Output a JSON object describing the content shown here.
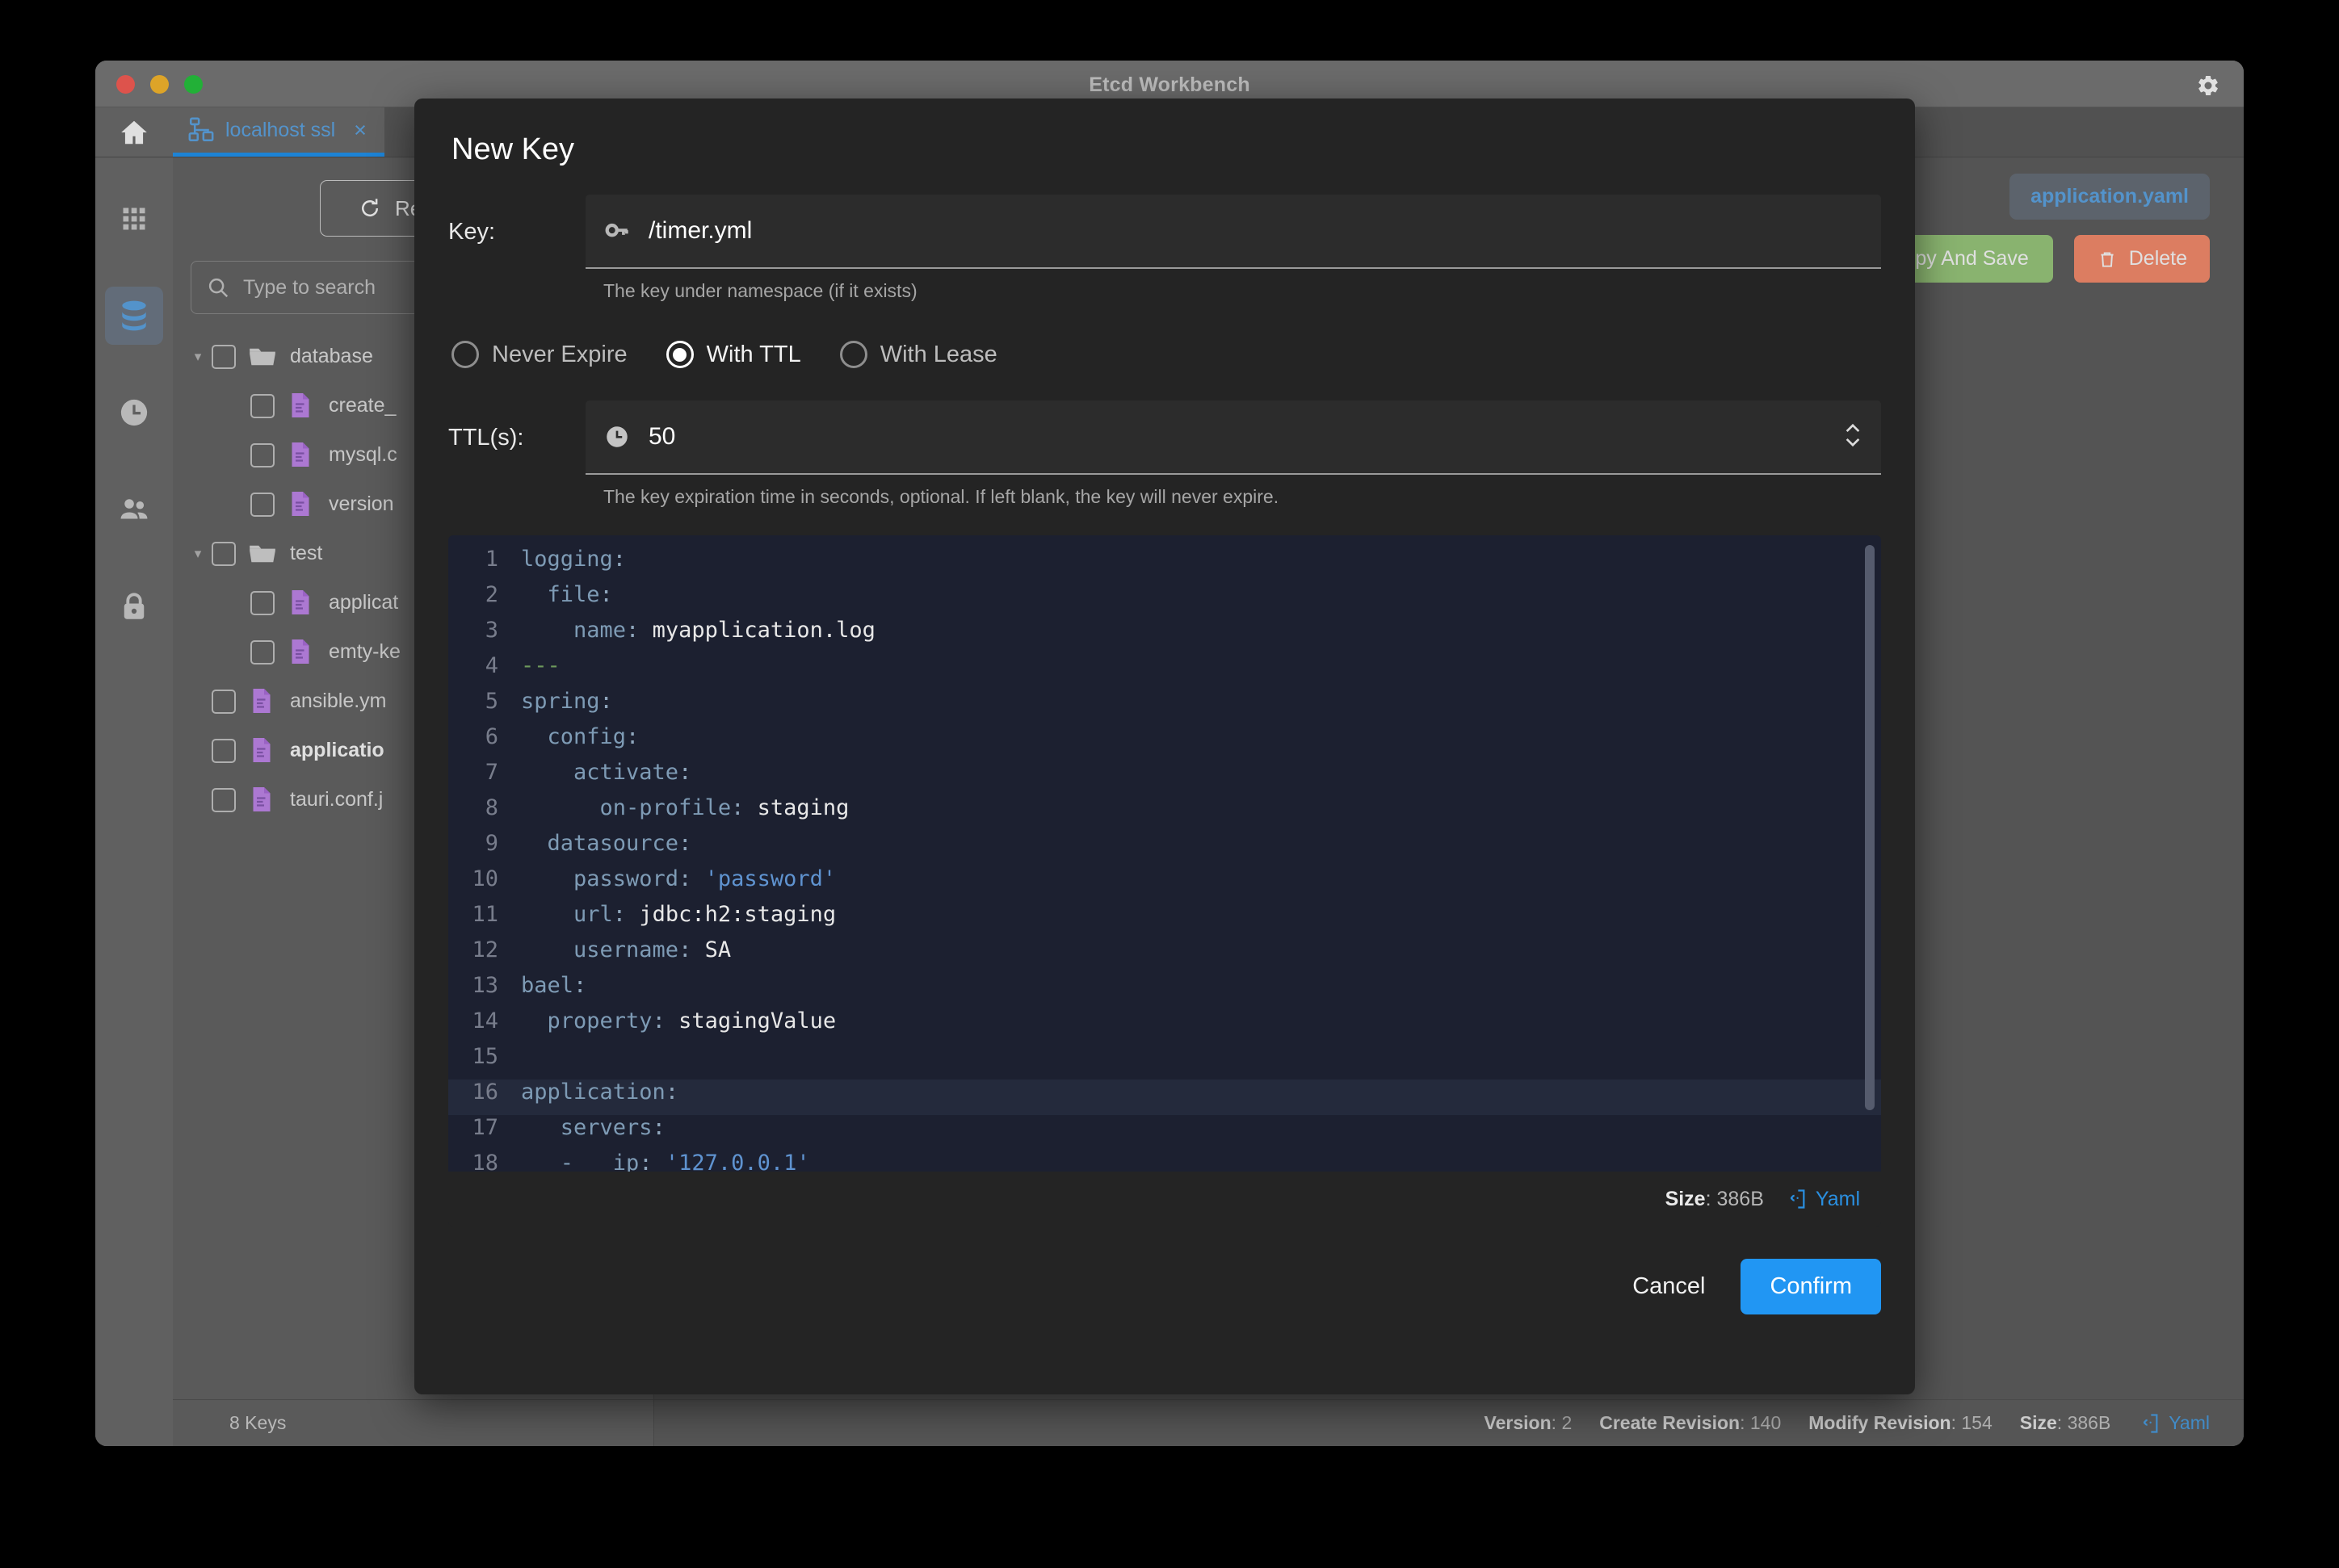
{
  "window": {
    "title": "Etcd Workbench",
    "gear_icon": "gear-icon",
    "traffic_lights": [
      "close-button",
      "minimize-button",
      "maximize-button"
    ]
  },
  "tabs": {
    "home_icon": "home-icon",
    "connection": {
      "icon": "server-network-icon",
      "label": "localhost ssl",
      "close": "×"
    }
  },
  "rail": {
    "items": [
      {
        "name": "sidebar-item-cluster",
        "icon": "grid-icon",
        "active": false
      },
      {
        "name": "sidebar-item-keys",
        "icon": "database-icon",
        "active": true
      },
      {
        "name": "sidebar-item-leases",
        "icon": "clock-icon",
        "active": false
      },
      {
        "name": "sidebar-item-users",
        "icon": "users-icon",
        "active": false
      },
      {
        "name": "sidebar-item-roles",
        "icon": "lock-icon",
        "active": false
      }
    ]
  },
  "keypane": {
    "refresh_label": "Refresh",
    "refresh_icon": "refresh-icon",
    "search": {
      "placeholder": "Type to search",
      "icon": "search-icon"
    },
    "tree": [
      {
        "indent": 0,
        "caret": "▾",
        "icon": "folder-icon",
        "label": "database",
        "bold": false
      },
      {
        "indent": 1,
        "caret": "",
        "icon": "yaml-file-icon",
        "label": "create_",
        "bold": false
      },
      {
        "indent": 1,
        "caret": "",
        "icon": "yaml-file-icon",
        "label": "mysql.c",
        "bold": false
      },
      {
        "indent": 1,
        "caret": "",
        "icon": "yaml-file-icon",
        "label": "version",
        "bold": false
      },
      {
        "indent": 0,
        "caret": "▾",
        "icon": "folder-icon",
        "label": "test",
        "bold": false
      },
      {
        "indent": 1,
        "caret": "",
        "icon": "yaml-file-icon",
        "label": "applicat",
        "bold": false
      },
      {
        "indent": 1,
        "caret": "",
        "icon": "yaml-file-icon",
        "label": "emty-ke",
        "bold": false
      },
      {
        "indent": 0,
        "caret": "",
        "icon": "yaml-file-icon",
        "label": "ansible.ym",
        "bold": false
      },
      {
        "indent": 0,
        "caret": "",
        "icon": "yaml-file-icon",
        "label": "applicatio",
        "bold": true
      },
      {
        "indent": 0,
        "caret": "",
        "icon": "yaml-file-icon",
        "label": "tauri.conf.j",
        "bold": false
      }
    ],
    "footer_count": "8 Keys"
  },
  "editor_pane": {
    "open_tab": "application.yaml",
    "copy_save_label": "opy And Save",
    "delete_label": "Delete",
    "delete_icon": "trash-icon",
    "status": {
      "version_label": "Version",
      "version_value": "2",
      "create_revision_label": "Create Revision",
      "create_revision_value": "140",
      "modify_revision_label": "Modify Revision",
      "modify_revision_value": "154",
      "size_label": "Size",
      "size_value": "386B",
      "lang_label": "Yaml",
      "lang_icon": "code-braces-icon"
    }
  },
  "modal": {
    "title": "New Key",
    "key_field": {
      "label": "Key:",
      "icon": "key-icon",
      "value": "/timer.yml",
      "hint": "The key under namespace (if it exists)"
    },
    "expire_options": [
      {
        "label": "Never Expire",
        "selected": false
      },
      {
        "label": "With TTL",
        "selected": true
      },
      {
        "label": "With Lease",
        "selected": false
      }
    ],
    "ttl_field": {
      "label": "TTL(s):",
      "icon": "clock-icon",
      "value": "50",
      "stepper_icon": "stepper-updown-icon",
      "hint": "The key expiration time in seconds, optional. If left blank, the key will never expire."
    },
    "code": {
      "lines": [
        {
          "no": "1",
          "active": false,
          "segs": [
            {
              "t": "logging",
              "c": "k"
            },
            {
              "t": ":",
              "c": "p"
            }
          ]
        },
        {
          "no": "2",
          "active": false,
          "segs": [
            {
              "t": "  file",
              "c": "k"
            },
            {
              "t": ":",
              "c": "p"
            }
          ]
        },
        {
          "no": "3",
          "active": false,
          "segs": [
            {
              "t": "    name",
              "c": "k"
            },
            {
              "t": ": ",
              "c": "p"
            },
            {
              "t": "myapplication.log",
              "c": "v"
            }
          ]
        },
        {
          "no": "4",
          "active": false,
          "segs": [
            {
              "t": "---",
              "c": "g"
            }
          ]
        },
        {
          "no": "5",
          "active": false,
          "segs": [
            {
              "t": "spring",
              "c": "k"
            },
            {
              "t": ":",
              "c": "p"
            }
          ]
        },
        {
          "no": "6",
          "active": false,
          "segs": [
            {
              "t": "  config",
              "c": "k"
            },
            {
              "t": ":",
              "c": "p"
            }
          ]
        },
        {
          "no": "7",
          "active": false,
          "segs": [
            {
              "t": "    activate",
              "c": "k"
            },
            {
              "t": ":",
              "c": "p"
            }
          ]
        },
        {
          "no": "8",
          "active": false,
          "segs": [
            {
              "t": "      on-profile",
              "c": "k"
            },
            {
              "t": ": ",
              "c": "p"
            },
            {
              "t": "staging",
              "c": "v"
            }
          ]
        },
        {
          "no": "9",
          "active": false,
          "segs": [
            {
              "t": "  datasource",
              "c": "k"
            },
            {
              "t": ":",
              "c": "p"
            }
          ]
        },
        {
          "no": "10",
          "active": false,
          "segs": [
            {
              "t": "    password",
              "c": "k"
            },
            {
              "t": ": ",
              "c": "p"
            },
            {
              "t": "'password'",
              "c": "s"
            }
          ]
        },
        {
          "no": "11",
          "active": false,
          "segs": [
            {
              "t": "    url",
              "c": "k"
            },
            {
              "t": ": ",
              "c": "p"
            },
            {
              "t": "jdbc:h2:staging",
              "c": "v"
            }
          ]
        },
        {
          "no": "12",
          "active": false,
          "segs": [
            {
              "t": "    username",
              "c": "k"
            },
            {
              "t": ": ",
              "c": "p"
            },
            {
              "t": "SA",
              "c": "v"
            }
          ]
        },
        {
          "no": "13",
          "active": false,
          "segs": [
            {
              "t": "bael",
              "c": "k"
            },
            {
              "t": ":",
              "c": "p"
            }
          ]
        },
        {
          "no": "14",
          "active": false,
          "segs": [
            {
              "t": "  property",
              "c": "k"
            },
            {
              "t": ": ",
              "c": "p"
            },
            {
              "t": "stagingValue",
              "c": "v"
            }
          ]
        },
        {
          "no": "15",
          "active": false,
          "segs": [
            {
              "t": "",
              "c": "v"
            }
          ]
        },
        {
          "no": "16",
          "active": true,
          "segs": [
            {
              "t": "application",
              "c": "k"
            },
            {
              "t": ":",
              "c": "p"
            }
          ]
        },
        {
          "no": "17",
          "active": false,
          "segs": [
            {
              "t": "   servers",
              "c": "k"
            },
            {
              "t": ":",
              "c": "p"
            }
          ]
        },
        {
          "no": "18",
          "active": false,
          "segs": [
            {
              "t": "   -   ip",
              "c": "k"
            },
            {
              "t": ": ",
              "c": "p"
            },
            {
              "t": "'127.0.0.1'",
              "c": "s"
            }
          ]
        }
      ],
      "footer": {
        "size_label": "Size",
        "size_value": "386B",
        "lang_label": "Yaml",
        "lang_icon": "code-braces-icon"
      }
    },
    "cancel_label": "Cancel",
    "confirm_label": "Confirm"
  },
  "colors": {
    "accent_blue": "#2196f3",
    "tab_blue": "#5fa8e8",
    "green_button": "#9ccc7f",
    "red_button": "#fb8f6f",
    "file_icon_purple": "#c489f0",
    "code_bg": "#1c2030"
  }
}
